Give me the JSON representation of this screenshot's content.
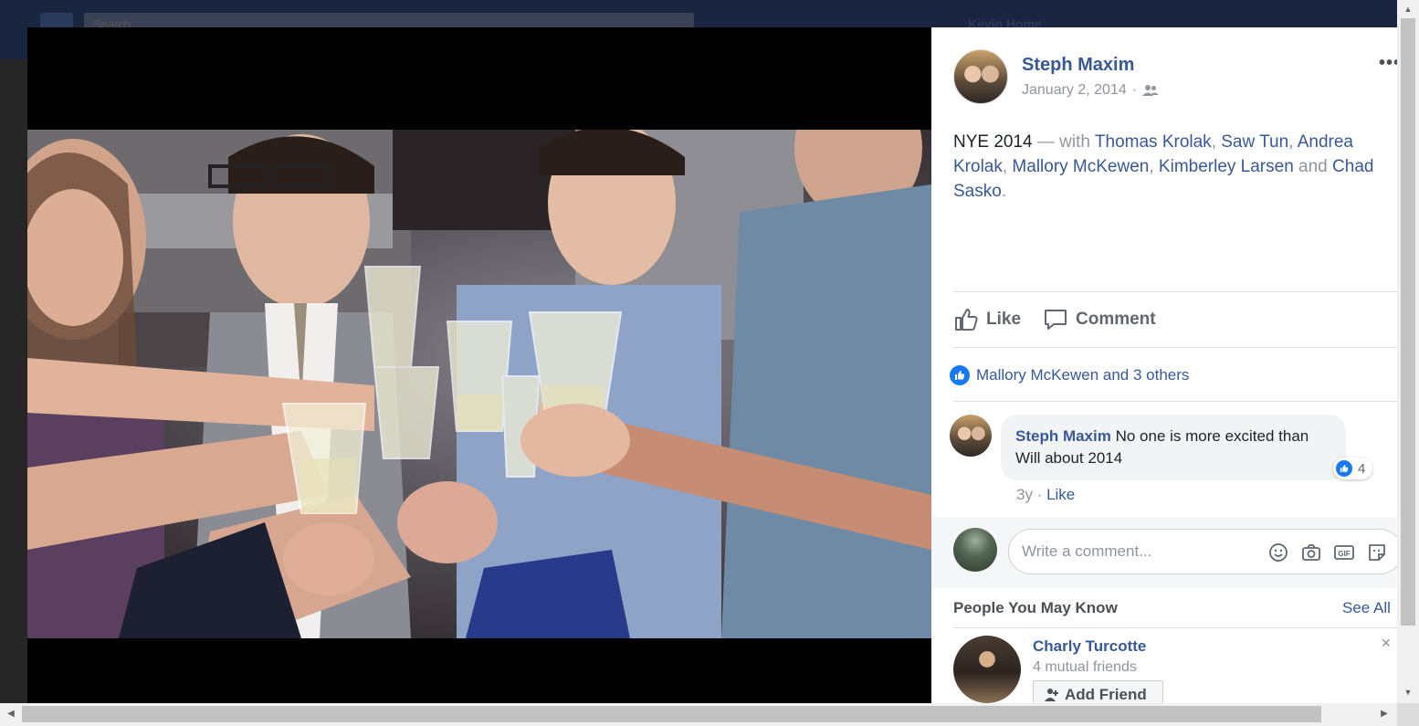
{
  "background": {
    "search_placeholder": "Search",
    "nav_text": "Kevin    Home"
  },
  "post": {
    "author": "Steph Maxim",
    "date": "January 2, 2014",
    "separator": "·",
    "audience_icon": "friends-icon",
    "more_icon": "•••",
    "text": {
      "title": "NYE 2014",
      "with": " — with ",
      "tagged": [
        "Thomas Krolak",
        "Saw Tun",
        "Andrea Krolak",
        "Mallory McKewen",
        "Kimberley Larsen"
      ],
      "and": " and ",
      "last_tagged": "Chad Sasko",
      "end": "."
    },
    "actions": {
      "like": "Like",
      "comment": "Comment"
    },
    "likes_summary": "Mallory McKewen and 3 others"
  },
  "comment": {
    "author": "Steph Maxim",
    "text": " No one is more excited than Will about 2014",
    "reaction_count": "4",
    "age": "3y",
    "dot": " · ",
    "like_label": "Like"
  },
  "composer": {
    "placeholder": "Write a comment...",
    "icons": [
      "emoji-icon",
      "camera-icon",
      "gif-icon",
      "sticker-icon"
    ]
  },
  "people_you_may_know": {
    "title": "People You May Know",
    "see_all": "See All",
    "person": {
      "name": "Charly Turcotte",
      "mutual": "4 mutual friends",
      "add_friend": "Add Friend"
    }
  },
  "colors": {
    "link": "#385898",
    "like_blue": "#1877f2",
    "text": "#1d2129",
    "muted": "#90949c"
  }
}
